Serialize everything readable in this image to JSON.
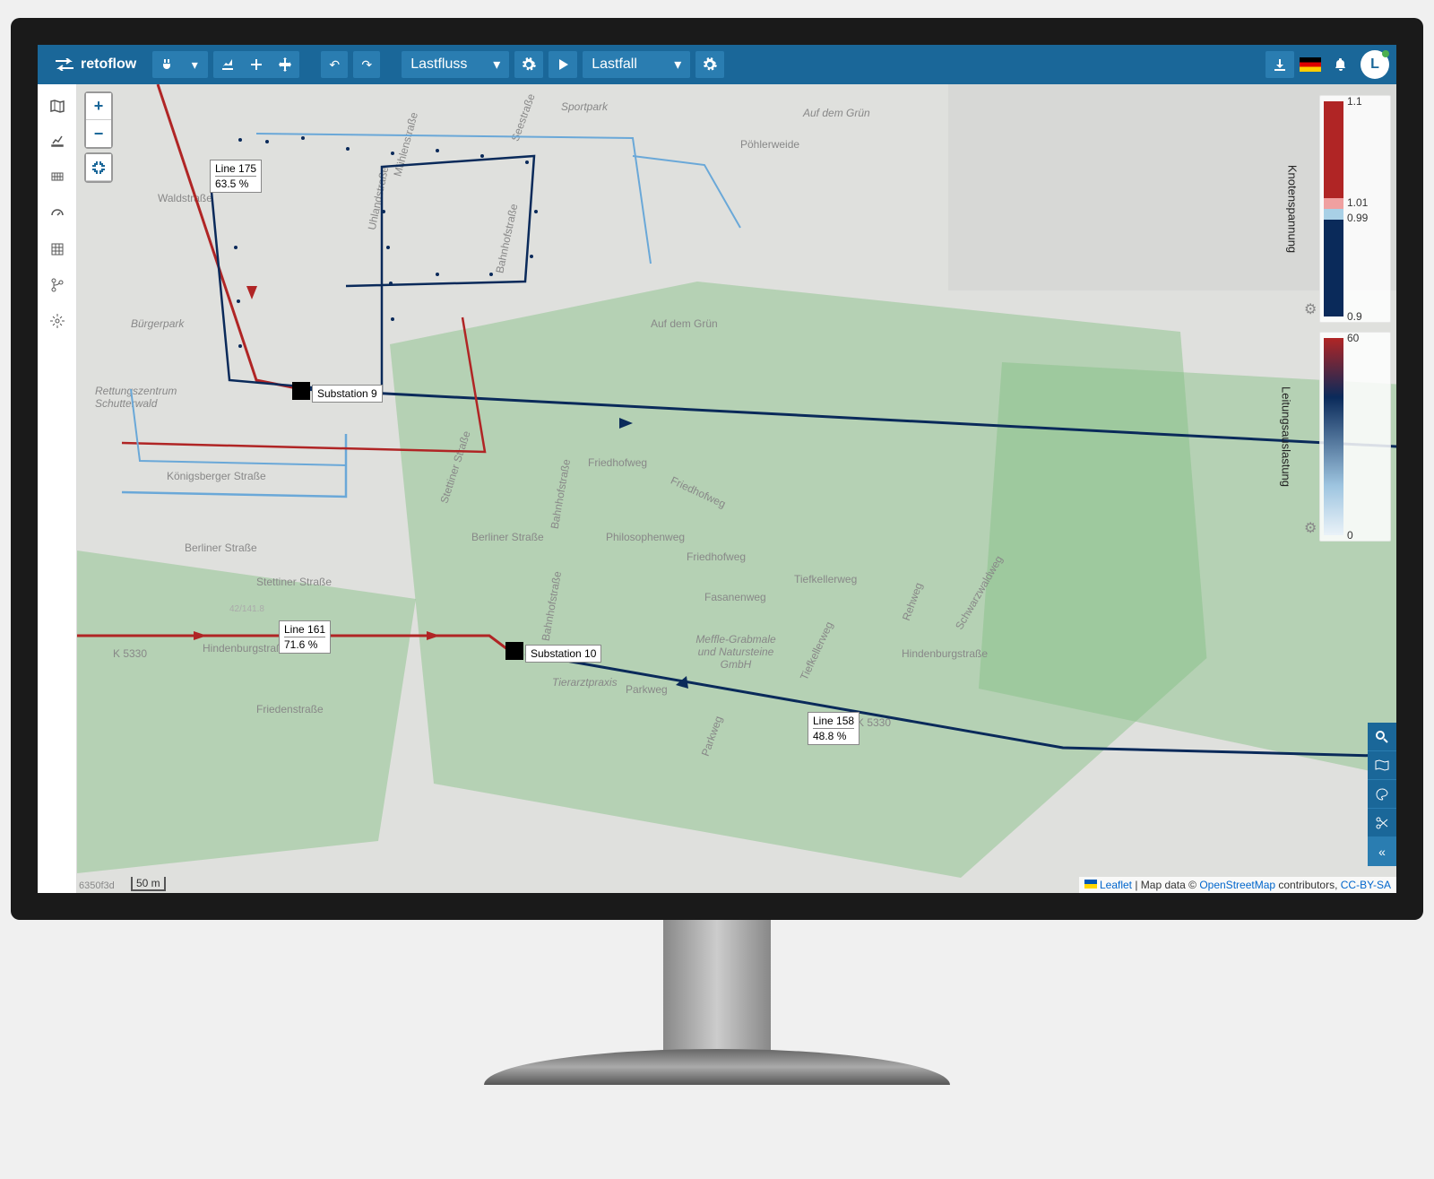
{
  "brand": "retoflow",
  "user_initial": "L",
  "dropdowns": {
    "analysis": "Lastfluss",
    "scenario": "Lastfall"
  },
  "map": {
    "scale": "50 m",
    "hash": "6350f3d",
    "attribution": {
      "leaflet": "Leaflet",
      "sep": " | Map data © ",
      "osm": "OpenStreetMap",
      "contrib": " contributors, ",
      "license": "CC-BY-SA"
    }
  },
  "substations": [
    {
      "id": "sub9",
      "label": "Substation 9"
    },
    {
      "id": "sub10",
      "label": "Substation 10"
    }
  ],
  "lines": [
    {
      "id": "l175",
      "name": "Line 175",
      "pct": "63.5 %"
    },
    {
      "id": "l161",
      "name": "Line 161",
      "pct": "71.6 %"
    },
    {
      "id": "l158",
      "name": "Line 158",
      "pct": "48.8 %"
    }
  ],
  "streets": [
    "Waldstraße",
    "Bürgerpark",
    "Rettungszentrum Schutterwald",
    "Königsberger Straße",
    "Berliner Straße",
    "Berliner Straße",
    "Stettiner Straße",
    "Stettiner Straße",
    "Hindenburgstraße",
    "Hindenburgstraße",
    "Friedenstraße",
    "Bahnhofstraße",
    "Sportpark",
    "Seestraße",
    "Pöhlerweide",
    "Auf dem Grün",
    "Auf dem Grün",
    "Friedhofweg",
    "Friedhofweg",
    "Friedhofweg",
    "Philosophenweg",
    "Fasanenweg",
    "Tiefkellerweg",
    "Tiefkellerweg",
    "Rehweg",
    "Schwarzwaldweg",
    "Parkweg",
    "Parkweg",
    "Tierarztpraxis",
    "Meffle-Grabmale und Natursteine GmbH",
    "K 5330",
    "K 5330",
    "42/141.8",
    "Uhlandstraße",
    "Mühlenstraße",
    "Bahnhofstraße",
    "Bahnhofstraße"
  ],
  "legends": [
    {
      "title": "Knotenspannung",
      "ticks": [
        "1.1",
        "1.01",
        "0.99",
        "0.9"
      ]
    },
    {
      "title": "Leitungsauslastung",
      "ticks": [
        "60",
        "0"
      ]
    }
  ],
  "chart_data": [
    {
      "type": "heatmap",
      "title": "Knotenspannung",
      "ylim": [
        0.9,
        1.1
      ],
      "thresholds": [
        0.99,
        1.01
      ],
      "colors": {
        "low": "#0a2a5a",
        "band_low": "#a8d0e6",
        "band_high": "#f0a0a0",
        "high": "#b02525"
      }
    },
    {
      "type": "heatmap",
      "title": "Leitungsauslastung",
      "ylim": [
        0,
        60
      ],
      "gradient": [
        "#eaf2f8",
        "#0a2a5a",
        "#b02525"
      ]
    }
  ]
}
